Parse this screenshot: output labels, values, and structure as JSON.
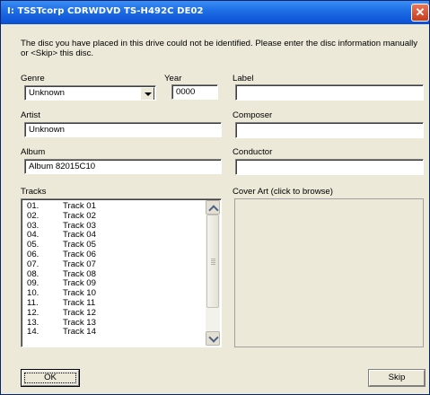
{
  "window": {
    "title": "I: TSSTcorp CDRWDVD TS-H492C DE02",
    "close_glyph": "✕"
  },
  "message": "The disc you have placed in this drive could not be identified.  Please enter the disc information manually or <Skip> this disc.",
  "fields": {
    "genre_label": "Genre",
    "genre_value": "Unknown",
    "year_label": "Year",
    "year_value": "0000",
    "label_label": "Label",
    "label_value": "",
    "artist_label": "Artist",
    "artist_value": "Unknown",
    "composer_label": "Composer",
    "composer_value": "",
    "album_label": "Album",
    "album_value": "Album 82015C10",
    "conductor_label": "Conductor",
    "conductor_value": ""
  },
  "tracks_label": "Tracks",
  "tracks": [
    {
      "num": "01.",
      "title": "Track 01"
    },
    {
      "num": "02.",
      "title": "Track 02"
    },
    {
      "num": "03.",
      "title": "Track 03"
    },
    {
      "num": "04.",
      "title": "Track 04"
    },
    {
      "num": "05.",
      "title": "Track 05"
    },
    {
      "num": "06.",
      "title": "Track 06"
    },
    {
      "num": "07.",
      "title": "Track 07"
    },
    {
      "num": "08.",
      "title": "Track 08"
    },
    {
      "num": "09.",
      "title": "Track 09"
    },
    {
      "num": "10.",
      "title": "Track 10"
    },
    {
      "num": "11.",
      "title": "Track 11"
    },
    {
      "num": "12.",
      "title": "Track 12"
    },
    {
      "num": "13.",
      "title": "Track 13"
    },
    {
      "num": "14.",
      "title": "Track 14"
    }
  ],
  "cover_art_label": "Cover Art (click to browse)",
  "buttons": {
    "ok": "OK",
    "skip": "Skip"
  },
  "colors": {
    "titlebar": "#0a4fd4",
    "dialog_bg": "#ece9d8"
  },
  "icons": {
    "close": "close-icon",
    "combo": "chevron-down-icon",
    "scroll_up": "chevron-up-icon",
    "scroll_down": "chevron-down-icon"
  }
}
